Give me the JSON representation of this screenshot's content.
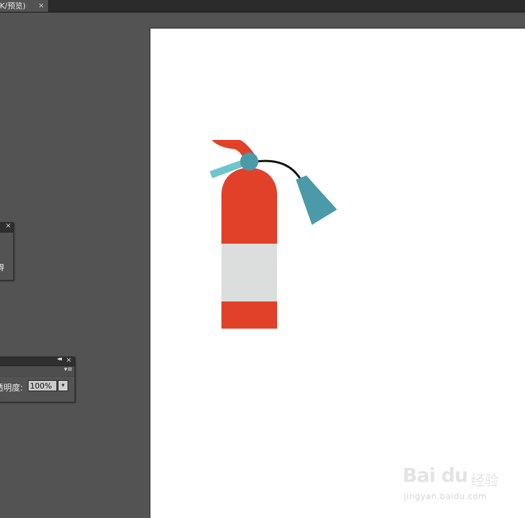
{
  "document_tab": {
    "title": "/K/预览)",
    "close_icon": "×"
  },
  "panels": {
    "small_panel": {
      "close_icon": "×",
      "label_fragment": "碍"
    },
    "transparency_panel": {
      "collapse_icon": "◂◂",
      "close_icon": "×",
      "menu_icon": "▾≡",
      "opacity_label": "透明度:",
      "opacity_value": "100%",
      "dropdown_icon": "▾"
    }
  },
  "artwork": {
    "subject": "fire-extinguisher",
    "colors": {
      "body_red": "#e04128",
      "band_gray": "#dcdedd",
      "valve_teal": "#4a9aaa",
      "lever_light_teal": "#6ec6cb",
      "hose_black": "#111111"
    }
  },
  "watermark": {
    "brand": "Bai du",
    "cn": "经验",
    "url": "jingyan.baidu.com"
  }
}
